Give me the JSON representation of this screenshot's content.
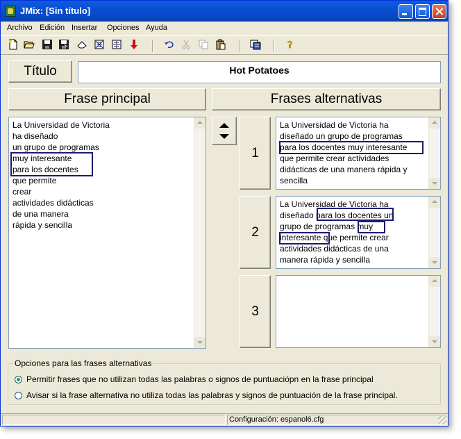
{
  "window": {
    "title": "JMix: [Sin título]"
  },
  "menu": [
    "Archivo",
    "Edición",
    "Insertar",
    "Opciones",
    "Ayuda"
  ],
  "toolbar_icons": [
    "new-file-icon",
    "open-folder-icon",
    "save-icon",
    "save-as-icon",
    "eraser-icon",
    "web-page-icon",
    "web-page-dragdrop-icon",
    "export-arrow-icon",
    "undo-icon",
    "cut-icon",
    "copy-icon",
    "paste-icon",
    "config-icon",
    "help-icon"
  ],
  "title_label": "Título",
  "title_value": "Hot Potatoes",
  "main_header": "Frase principal",
  "alt_header": "Frases alternativas",
  "main_lines": [
    "La Universidad de Victoria",
    "ha diseñado",
    "un grupo de programas",
    "muy interesante",
    "para los docentes",
    "que permite",
    "crear",
    "actividades didácticas",
    "de una manera",
    "rápida y sencilla"
  ],
  "alternatives": [
    {
      "number": "1",
      "lines": [
        "La Universidad de Victoria ha",
        "diseñado un grupo de programas",
        "para los docentes muy interesante",
        "que permite crear actividades",
        "didácticas de una manera rápida y",
        "sencilla"
      ]
    },
    {
      "number": "2",
      "lines": [
        "La Universidad de Victoria ha",
        "diseñado para los docentes un",
        "grupo de programas muy",
        "interesante que permite crear",
        "actividades didácticas de una",
        "manera rápida y sencilla"
      ]
    },
    {
      "number": "3",
      "lines": []
    }
  ],
  "options": {
    "legend": "Opciones para las frases alternativas",
    "option1": "Permitir frases que no utilizan todas las palabras o signos de puntuaciópn en la frase principal",
    "option2": "Avisar si la frase alternativa no utiliza todas las palabras y signos de puntuación de la frase principal.",
    "selected": 1
  },
  "status": {
    "config": "Configuración: espanol6.cfg"
  }
}
